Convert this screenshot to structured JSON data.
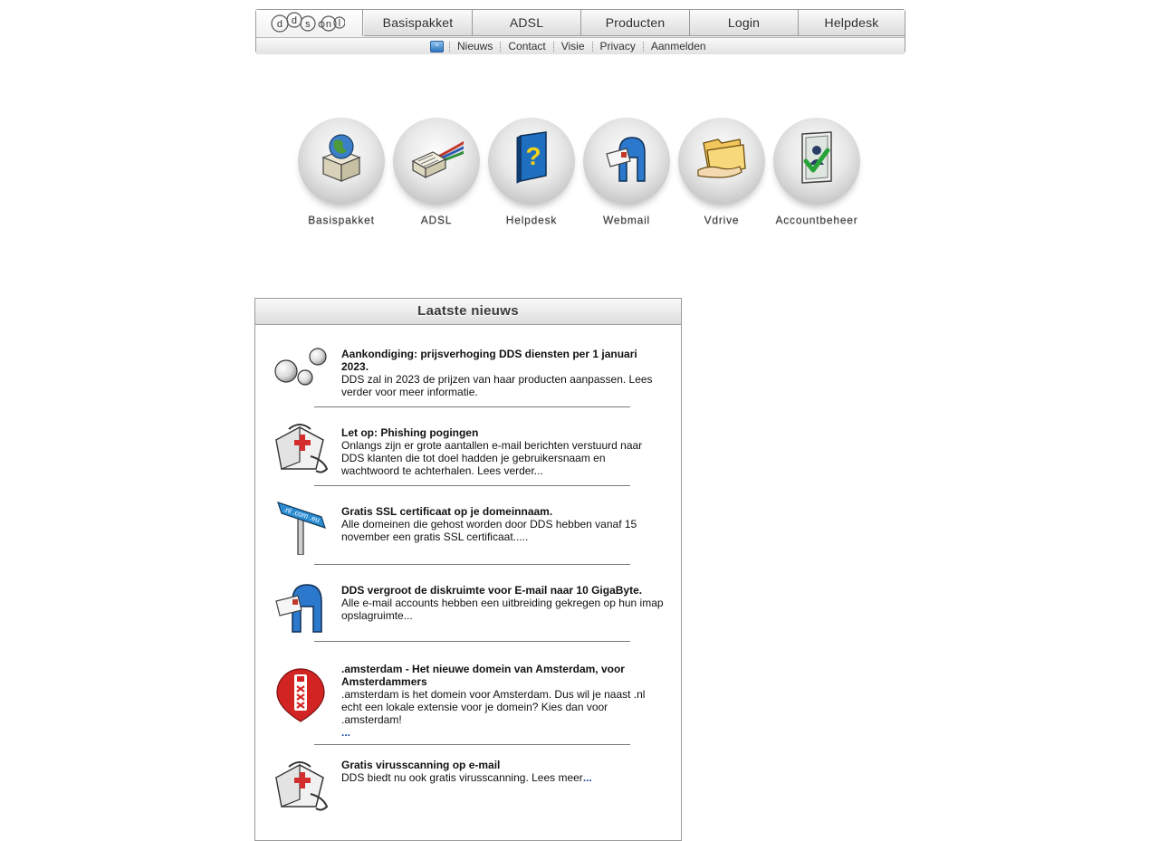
{
  "nav": {
    "logo_letters": [
      "d",
      "d",
      "s",
      "n",
      "l"
    ],
    "tabs": [
      "Basispakket",
      "ADSL",
      "Producten",
      "Login",
      "Helpdesk"
    ],
    "sub_links": [
      "Nieuws",
      "Contact",
      "Visie",
      "Privacy",
      "Aanmelden"
    ]
  },
  "services": [
    {
      "label": "Basispakket",
      "icon": "globe-box-icon"
    },
    {
      "label": "ADSL",
      "icon": "network-cable-icon"
    },
    {
      "label": "Helpdesk",
      "icon": "help-book-icon"
    },
    {
      "label": "Webmail",
      "icon": "mailbox-icon"
    },
    {
      "label": "Vdrive",
      "icon": "folder-hand-icon"
    },
    {
      "label": "Accountbeheer",
      "icon": "account-check-icon"
    }
  ],
  "news": {
    "heading": "Laatste nieuws",
    "items": [
      {
        "icon": "bubbles-icon",
        "title": "Aankondiging: prijsverhoging DDS diensten per 1 januari 2023.",
        "body": "DDS zal in 2023 de prijzen van haar producten aanpassen. Lees verder voor meer informatie.",
        "more": ""
      },
      {
        "icon": "first-aid-bag-icon",
        "title": "Let op: Phishing pogingen",
        "body": "Onlangs zijn er grote aantallen e-mail berichten verstuurd naar DDS klanten die tot doel hadden je gebruikersnaam en wachtwoord te achterhalen. Lees verder...",
        "more": ""
      },
      {
        "icon": "signpost-icon",
        "title": "Gratis SSL certificaat op je domeinnaam.",
        "body": "Alle domeinen die gehost worden door DDS hebben vanaf 15 november een gratis SSL certificaat.....",
        "more": ""
      },
      {
        "icon": "mailbox-icon",
        "title": "DDS vergroot de diskruimte voor E-mail naar 10 GigaByte.",
        "body": "Alle e-mail accounts hebben een uitbreiding gekregen op hun imap opslagruimte...",
        "more": ""
      },
      {
        "icon": "amsterdam-pin-icon",
        "title": ".amsterdam - Het nieuwe domein van Amsterdam, voor Amsterdammers",
        "body": ".amsterdam is het domein voor Amsterdam. Dus wil je naast .nl echt een lokale extensie voor je domein? Kies dan voor .amsterdam!",
        "more": "..."
      },
      {
        "icon": "first-aid-bag-icon",
        "title": "Gratis virusscanning op e-mail",
        "body": "DDS biedt nu ook gratis virusscanning. Lees meer",
        "more": "..."
      }
    ]
  }
}
